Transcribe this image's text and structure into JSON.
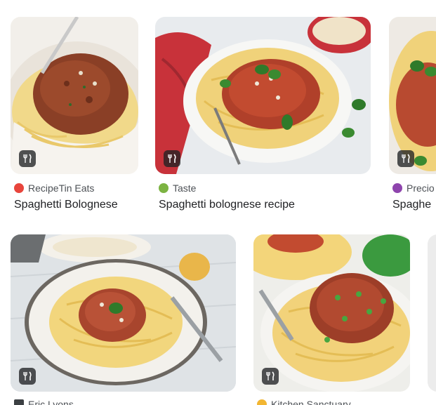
{
  "row1": [
    {
      "source": "RecipeTin Eats",
      "title": "Spaghetti Bolognese",
      "favicon_color": "#e8453c",
      "badge_icon": "fork-knife-icon"
    },
    {
      "source": "Taste",
      "title": "Spaghetti bolognese recipe",
      "favicon_color": "#7cb342",
      "badge_icon": "fork-knife-icon"
    },
    {
      "source": "Precio",
      "title": "Spaghe",
      "favicon_color": "#8e44ad",
      "badge_icon": "fork-knife-icon"
    }
  ],
  "row2": [
    {
      "source": "Eric Lyons",
      "badge_icon": "fork-knife-icon"
    },
    {
      "source": "Kitchen Sanctuary",
      "badge_icon": "fork-knife-icon"
    }
  ]
}
